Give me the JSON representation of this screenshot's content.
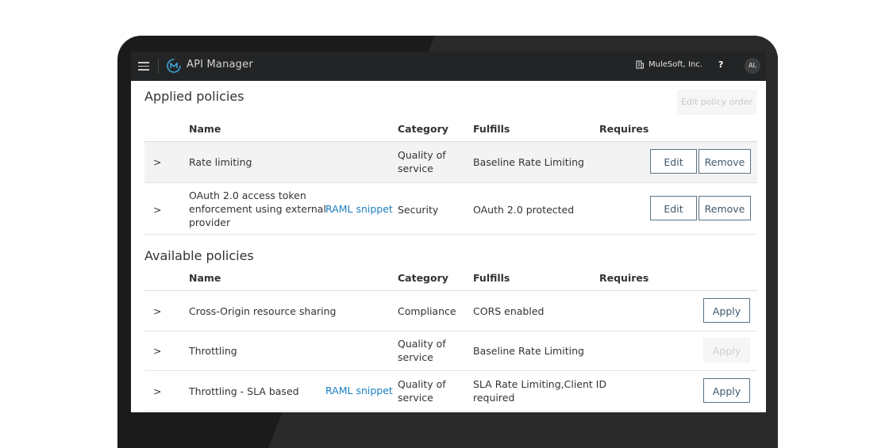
{
  "topbar": {
    "app_title": "API Manager",
    "org_name": "MuleSoft, Inc.",
    "help_label": "?",
    "avatar_initials": "AL"
  },
  "applied": {
    "title": "Applied policies",
    "edit_order_label": "Edit policy order",
    "headers": {
      "name": "Name",
      "category": "Category",
      "fulfills": "Fulfills",
      "requires": "Requires"
    },
    "rows": [
      {
        "chevron": ">",
        "name": "Rate limiting",
        "category": [
          "Quality of",
          "service"
        ],
        "fulfills": "Baseline Rate Limiting",
        "edit": "Edit",
        "remove": "Remove"
      },
      {
        "chevron": ">",
        "name": [
          "OAuth 2.0 access token",
          "enforcement using external",
          "provider"
        ],
        "raml": "RAML snippet",
        "category": "Security",
        "fulfills": "OAuth 2.0 protected",
        "edit": "Edit",
        "remove": "Remove"
      }
    ]
  },
  "available": {
    "title": "Available policies",
    "headers": {
      "name": "Name",
      "category": "Category",
      "fulfills": "Fulfills",
      "requires": "Requires"
    },
    "rows": [
      {
        "chevron": ">",
        "name": "Cross-Origin resource sharing",
        "category": "Compliance",
        "fulfills": "CORS enabled",
        "apply": "Apply"
      },
      {
        "chevron": ">",
        "name": "Throttling",
        "category": [
          "Quality of",
          "service"
        ],
        "fulfills": "Baseline Rate Limiting",
        "apply": "Apply"
      },
      {
        "chevron": ">",
        "name": "Throttling - SLA based",
        "raml": "RAML snippet",
        "category": [
          "Quality of",
          "service"
        ],
        "fulfills": [
          "SLA Rate Limiting,Client ID",
          "required"
        ],
        "apply": "Apply"
      }
    ]
  },
  "colors": {
    "topbar": "#222425",
    "link": "#1a7fc0",
    "button_border": "#5b7384",
    "row_shade": "#f3f3f3"
  }
}
